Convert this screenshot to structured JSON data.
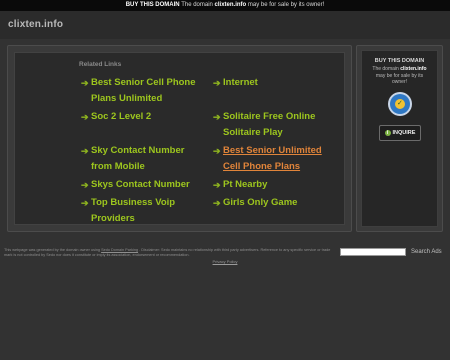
{
  "topbar": {
    "buy": "BUY THIS DOMAIN",
    "pre": "The domain",
    "domain": "clixten.info",
    "post": "may be for sale by its owner!"
  },
  "site": {
    "name": "clixten.info"
  },
  "related": {
    "title": "Related Links",
    "left": [
      {
        "label": "Best Senior Cell Phone Plans Unlimited"
      },
      {
        "label": "Soc 2 Level 2"
      },
      {
        "label": "Sky Contact Number from Mobile"
      },
      {
        "label": "Skys Contact Number"
      },
      {
        "label": "Top Business Voip Providers"
      }
    ],
    "right": [
      {
        "label": "Internet"
      },
      {
        "label": "Solitaire Free Online Solitaire Play"
      },
      {
        "label": "Best Senior Unlimited Cell Phone Plans"
      },
      {
        "label": "Pt Nearby"
      },
      {
        "label": "Girls Only Game"
      }
    ]
  },
  "side": {
    "title": "BUY THIS DOMAIN",
    "pre": "The domain",
    "domain": "clixten.info",
    "post": "may be for sale by its owner!",
    "button": "INQUIRE"
  },
  "footer": {
    "text1": "This webpage was generated by the domain owner using",
    "link": "Sedo Domain Parking",
    "text2": ". Disclaimer: Sedo maintains no relationship with third party advertisers. Reference to any specific service or trade mark is not controlled by Sedo nor does it constitute or imply its association, endorsement or recommendation.",
    "search_label": "Search Ads",
    "privacy": "Privacy Policy"
  },
  "colors": {
    "link": "#9dc61e",
    "link_highlight": "#e0843a",
    "background": "#323232"
  },
  "icons": {
    "link_arrow": "arrow-right-icon",
    "seal": "verified-seal-icon",
    "inquire": "info-icon"
  }
}
